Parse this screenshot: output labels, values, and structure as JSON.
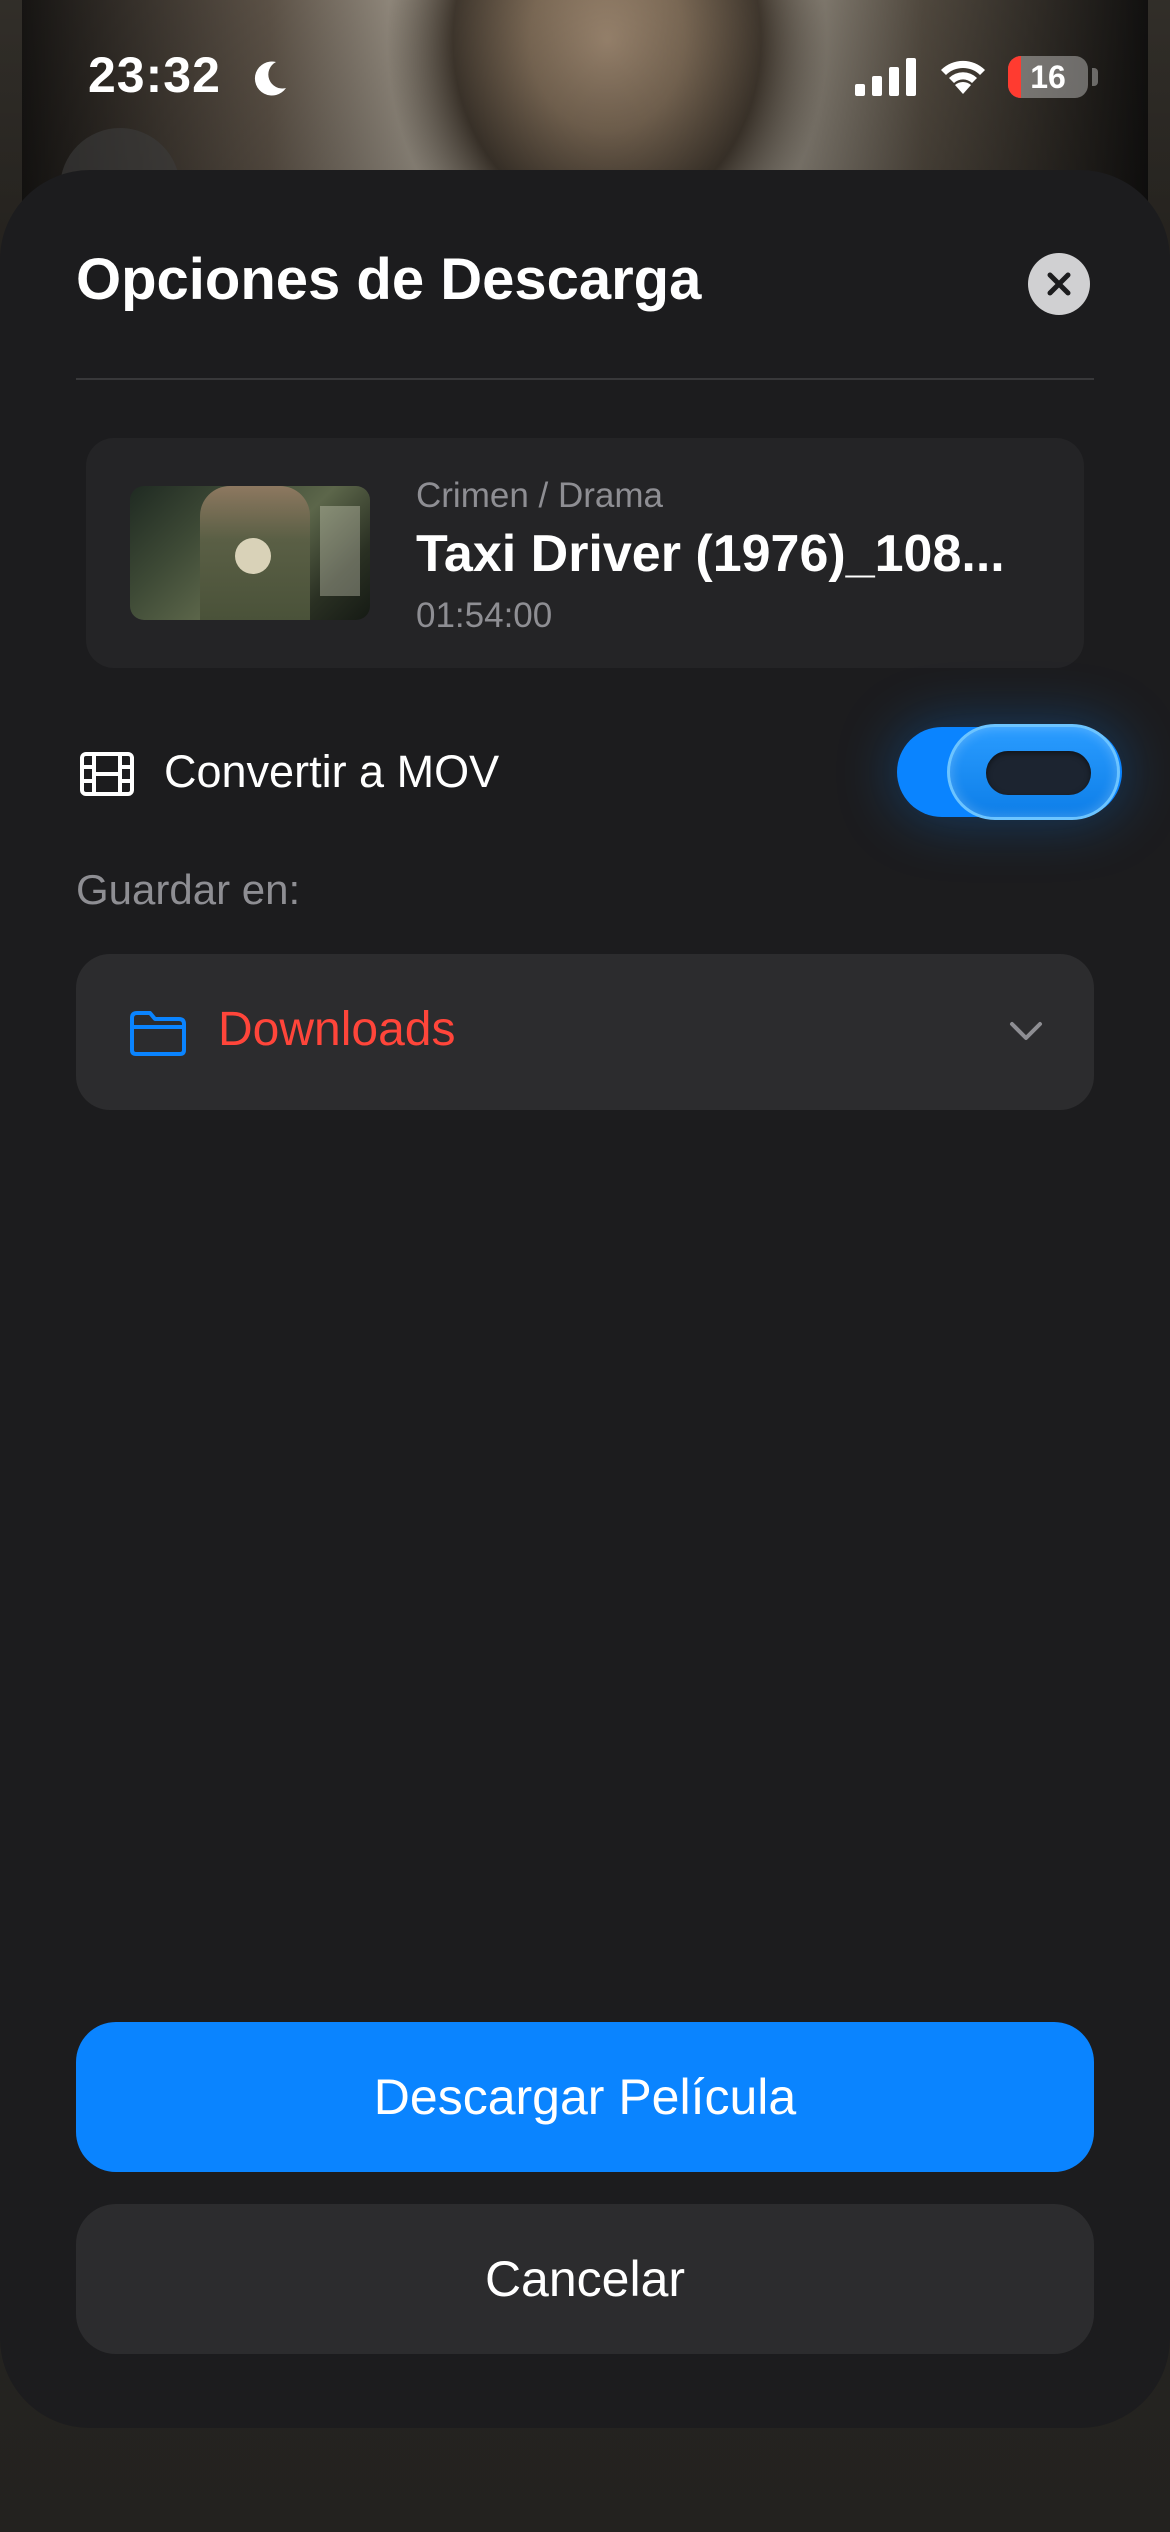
{
  "status_bar": {
    "time": "23:32",
    "battery_level": "16",
    "battery_fraction": 0.16,
    "icons": [
      "moon-icon",
      "signal-icon",
      "wifi-icon",
      "battery-icon"
    ]
  },
  "sheet": {
    "title": "Opciones de Descarga",
    "close_icon": "close-icon"
  },
  "movie": {
    "genre": "Crimen /  Drama",
    "title": "Taxi Driver (1976)_108...",
    "duration": "01:54:00"
  },
  "convert": {
    "icon": "film-icon",
    "label": "Convertir a MOV",
    "enabled": true
  },
  "save": {
    "label": "Guardar en:",
    "folder_icon": "folder-icon",
    "folder": "Downloads",
    "chevron_icon": "chevron-down-icon"
  },
  "actions": {
    "download": "Descargar Película",
    "cancel": "Cancelar"
  },
  "colors": {
    "accent": "#0a84ff",
    "folder_text": "#ff453a",
    "sheet_bg": "#1c1c1e",
    "card_bg": "#2c2c2e"
  }
}
